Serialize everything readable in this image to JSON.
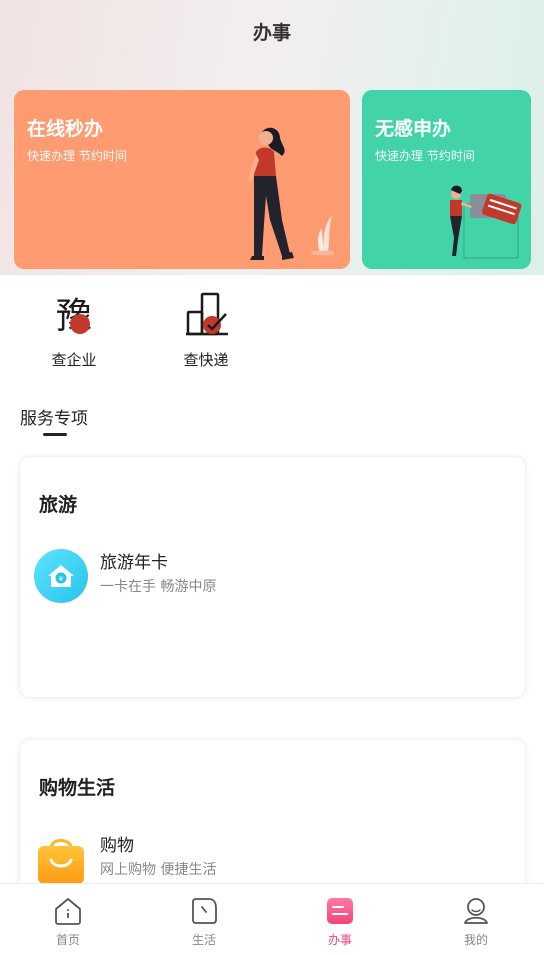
{
  "header": {
    "title": "办事"
  },
  "banners": [
    {
      "title": "在线秒办",
      "subtitle": "快速办理 节约时间",
      "color": "#ff9b70"
    },
    {
      "title": "无感申办",
      "subtitle": "快速办理 节约时间",
      "color": "#42d4a8"
    }
  ],
  "quick_actions": [
    {
      "label": "查企业",
      "icon": "enterprise-seal-icon"
    },
    {
      "label": "查快递",
      "icon": "express-check-icon"
    }
  ],
  "section": {
    "title": "服务专项"
  },
  "cards": [
    {
      "title": "旅游",
      "items": [
        {
          "name": "旅游年卡",
          "desc": "一卡在手 畅游中原",
          "icon": "travel-card-icon"
        }
      ]
    },
    {
      "title": "购物生活",
      "items": [
        {
          "name": "购物",
          "desc": "网上购物 便捷生活",
          "icon": "shopping-bag-icon"
        }
      ]
    }
  ],
  "tabbar": {
    "items": [
      {
        "label": "首页",
        "icon": "home-icon"
      },
      {
        "label": "生活",
        "icon": "life-icon"
      },
      {
        "label": "办事",
        "icon": "affairs-icon",
        "active": true
      },
      {
        "label": "我的",
        "icon": "profile-icon"
      }
    ],
    "active_color": "#f0457b"
  }
}
